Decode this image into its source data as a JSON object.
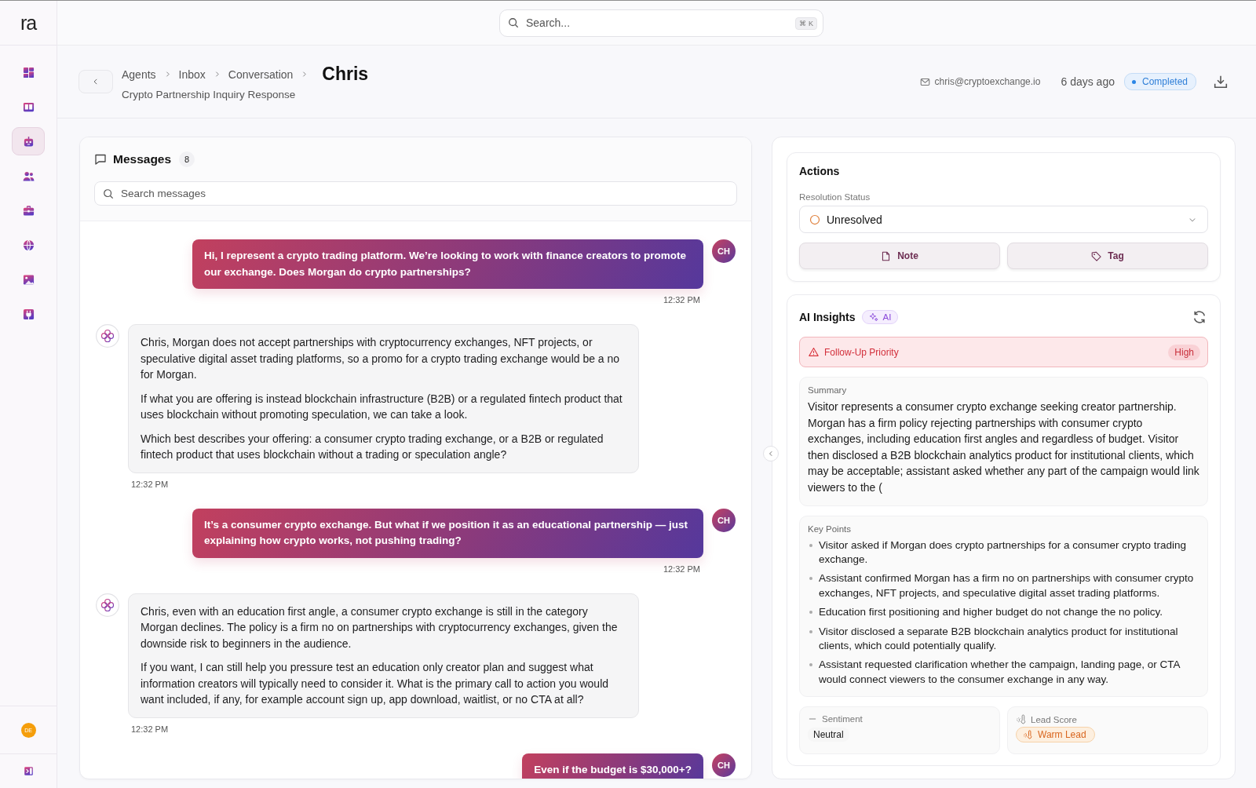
{
  "app": {
    "logo": "ra"
  },
  "search": {
    "placeholder": "Search...",
    "shortcut": "⌘ K"
  },
  "sidebar": {
    "items": [
      {
        "selected": false
      },
      {
        "selected": false
      },
      {
        "selected": true
      },
      {
        "selected": false
      },
      {
        "selected": false
      },
      {
        "selected": false
      },
      {
        "selected": false
      },
      {
        "selected": false
      }
    ],
    "user_initials": "DE"
  },
  "header": {
    "breadcrumbs": [
      "Agents",
      "Inbox",
      "Conversation"
    ],
    "title": "Chris",
    "subtitle": "Crypto Partnership Inquiry Response",
    "email": "chris@cryptoexchange.io",
    "time": "6 days ago",
    "status": "Completed"
  },
  "messages": {
    "title": "Messages",
    "count": "8",
    "search_placeholder": "Search messages",
    "items": [
      {
        "kind": "visitor",
        "avatar": "CH",
        "paragraphs": [
          "Hi, I represent a crypto trading platform. We’re looking to work with finance creators to promote our exchange. Does Morgan do crypto partnerships?"
        ],
        "time": "12:32 PM"
      },
      {
        "kind": "assistant",
        "paragraphs": [
          "Chris, Morgan does not accept partnerships with cryptocurrency exchanges, NFT projects, or speculative digital asset trading platforms, so a promo for a crypto trading exchange would be a no for Morgan.",
          "If what you are offering is instead blockchain infrastructure (B2B) or a regulated fintech product that uses blockchain without promoting speculation, we can take a look.",
          "Which best describes your offering: a consumer crypto trading exchange, or a B2B or regulated fintech product that uses blockchain without a trading or speculation angle?"
        ],
        "time": "12:32 PM"
      },
      {
        "kind": "visitor",
        "avatar": "CH",
        "paragraphs": [
          "It’s a consumer crypto exchange. But what if we position it as an educational partnership — just explaining how crypto works, not pushing trading?"
        ],
        "time": "12:32 PM"
      },
      {
        "kind": "assistant",
        "paragraphs": [
          "Chris, even with an education first angle, a consumer crypto exchange is still in the category Morgan declines. The policy is a firm no on partnerships with cryptocurrency exchanges, given the downside risk to beginners in the audience.",
          "If you want, I can still help you pressure test an education only creator plan and suggest what information creators will typically need to consider it. What is the primary call to action you would want included, if any, for example account sign up, app download, waitlist, or no CTA at all?"
        ],
        "time": "12:32 PM"
      },
      {
        "kind": "visitor",
        "avatar": "CH",
        "paragraphs": [
          "Even if the budget is $30,000+?"
        ]
      }
    ]
  },
  "actions": {
    "title": "Actions",
    "status_label": "Resolution Status",
    "status_value": "Unresolved",
    "buttons": [
      "Note",
      "Tag"
    ]
  },
  "insights": {
    "title": "AI Insights",
    "badge": "AI",
    "priority": {
      "label": "Follow-Up Priority",
      "value": "High"
    },
    "summary": {
      "label": "Summary",
      "text": "Visitor represents a consumer crypto exchange seeking creator partnership. Morgan has a firm policy rejecting partnerships with consumer crypto exchanges, including education first angles and regardless of budget. Visitor then disclosed a B2B blockchain analytics product for institutional clients, which may be acceptable; assistant asked whether any part of the campaign would link viewers to the ("
    },
    "key_points": {
      "label": "Key Points",
      "items": [
        "Visitor asked if Morgan does crypto partnerships for a consumer crypto trading exchange.",
        "Assistant confirmed Morgan has a firm no on partnerships with consumer crypto exchanges, NFT projects, and speculative digital asset trading platforms.",
        "Education first positioning and higher budget do not change the no policy.",
        "Visitor disclosed a separate B2B blockchain analytics product for institutional clients, which could potentially qualify.",
        "Assistant requested clarification whether the campaign, landing page, or CTA would connect viewers to the consumer exchange in any way."
      ]
    },
    "sentiment": {
      "label": "Sentiment",
      "value": "Neutral"
    },
    "lead_score": {
      "label": "Lead Score",
      "value": "Warm Lead"
    }
  }
}
